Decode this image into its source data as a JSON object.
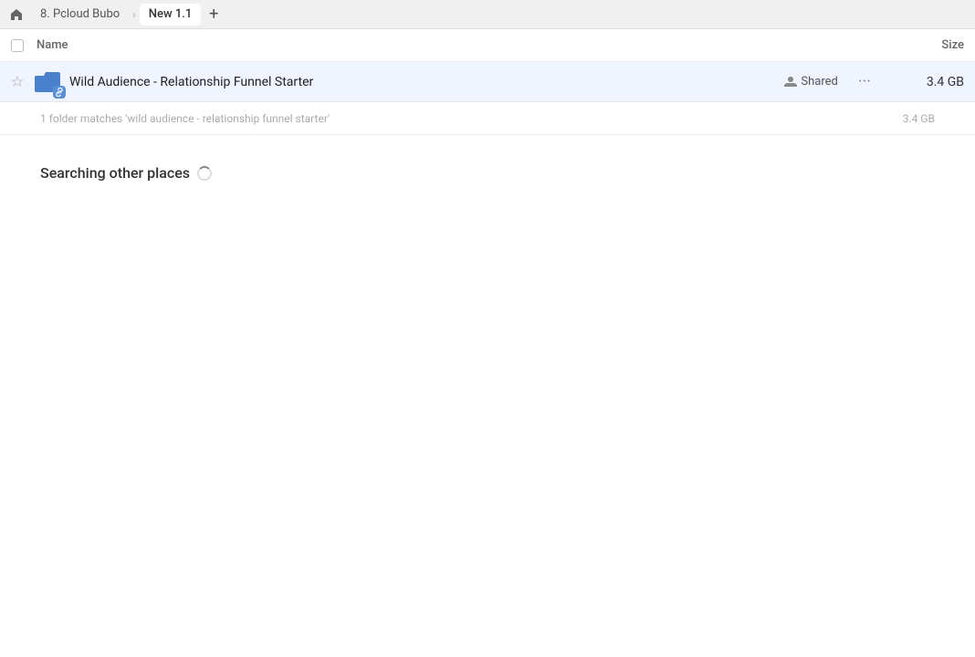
{
  "tabs": {
    "home_icon": "⌂",
    "breadcrumb_separator": "›",
    "tab1_label": "8. Pcloud Bubo",
    "tab2_label": "New 1.1",
    "add_icon": "+"
  },
  "columns": {
    "name_label": "Name",
    "size_label": "Size"
  },
  "file_row": {
    "name": "Wild Audience - Relationship Funnel Starter",
    "shared_label": "Shared",
    "size": "3.4 GB",
    "more_icon": "···"
  },
  "summary": {
    "text": "1 folder matches 'wild audience - relationship funnel starter'",
    "size": "3.4 GB"
  },
  "searching": {
    "label": "Searching other places"
  }
}
